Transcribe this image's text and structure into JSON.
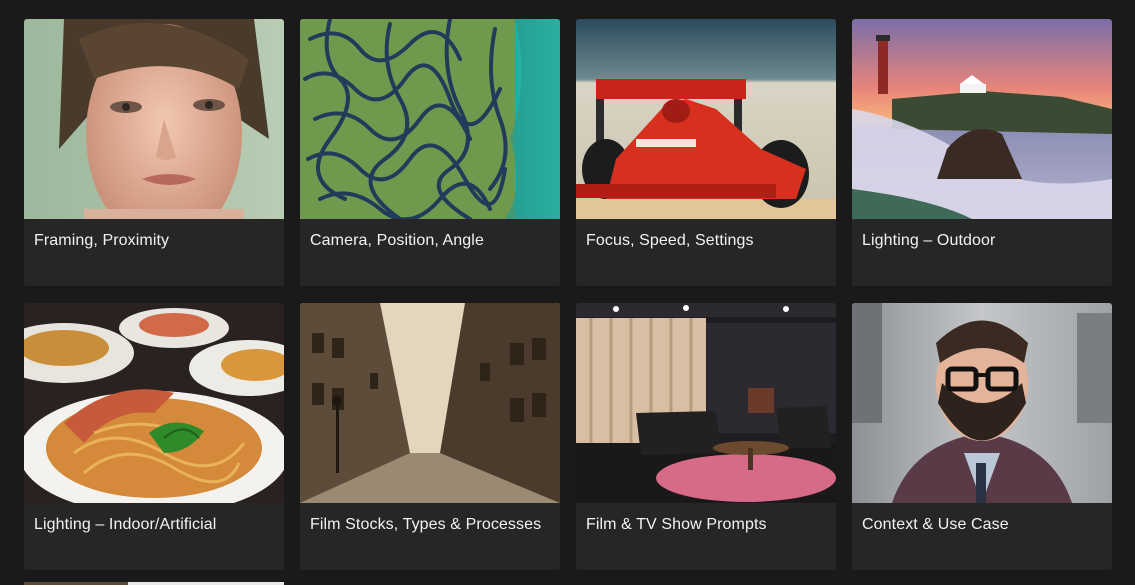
{
  "cards": [
    {
      "title": "Framing, Proximity",
      "image": "portrait-woman-closeup"
    },
    {
      "title": "Camera, Position, Angle",
      "image": "aerial-coral-maze"
    },
    {
      "title": "Focus, Speed, Settings",
      "image": "red-race-car"
    },
    {
      "title": "Lighting – Outdoor",
      "image": "lighthouse-sunset-sea"
    },
    {
      "title": "Lighting – Indoor/Artificial",
      "image": "pasta-dish"
    },
    {
      "title": "Film Stocks, Types & Processes",
      "image": "sepia-old-street"
    },
    {
      "title": "Film & TV Show Prompts",
      "image": "tv-studio-set"
    },
    {
      "title": "Context & Use Case",
      "image": "bearded-man-glasses"
    }
  ]
}
